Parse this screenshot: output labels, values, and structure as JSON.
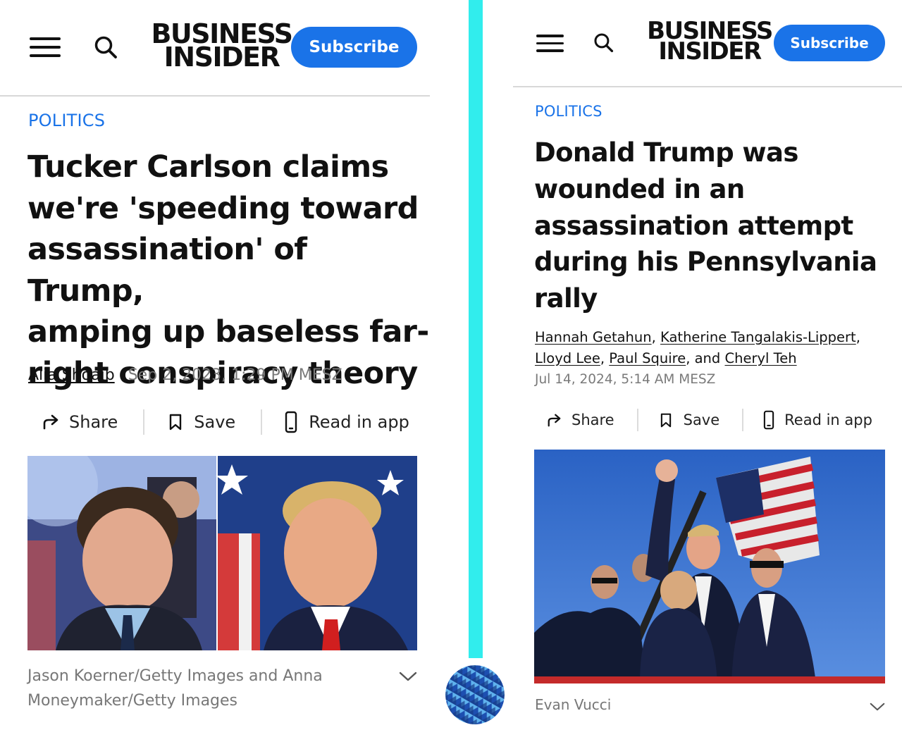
{
  "left": {
    "header": {
      "menu_icon": "hamburger-icon",
      "search_icon": "search-icon",
      "logo_line1": "BUSINESS",
      "logo_line2": "INSIDER",
      "subscribe_label": "Subscribe"
    },
    "article": {
      "kicker": "POLITICS",
      "headline_lines": [
        "Tucker Carlson claims",
        "we're 'speeding toward",
        "assassination' of Trump,",
        "amping up baseless far-",
        "right conspiracy theory"
      ],
      "author": "Alia Shoaib",
      "date": "Sep 2, 2023, 1:29 PM MESZ",
      "actions": {
        "share": "Share",
        "save": "Save",
        "read_in_app": "Read in app"
      },
      "caption_lines": [
        "Jason Koerner/Getty Images and Anna",
        "Moneymaker/Getty Images"
      ]
    }
  },
  "right": {
    "header": {
      "menu_icon": "hamburger-icon",
      "search_icon": "search-icon",
      "logo_line1": "BUSINESS",
      "logo_line2": "INSIDER",
      "subscribe_label": "Subscribe"
    },
    "article": {
      "kicker": "POLITICS",
      "headline_lines": [
        "Donald Trump was",
        "wounded in an",
        "assassination attempt",
        "during his Pennsylvania",
        "rally"
      ],
      "authors": [
        "Hannah Getahun",
        "Katherine Tangalakis-Lippert",
        "Lloyd Lee",
        "Paul Squire",
        "Cheryl Teh"
      ],
      "byline_sep1": ", ",
      "byline_sep2": ",",
      "byline_sep3": ", ",
      "byline_sep4": ", and ",
      "date": "Jul 14, 2024, 5:14 AM MESZ",
      "actions": {
        "share": "Share",
        "save": "Save",
        "read_in_app": "Read in app"
      },
      "caption": "Evan Vucci"
    }
  },
  "colors": {
    "accent": "#1a73e8",
    "divider": "#31eded",
    "text": "#111111",
    "muted": "#7a7a7a"
  }
}
